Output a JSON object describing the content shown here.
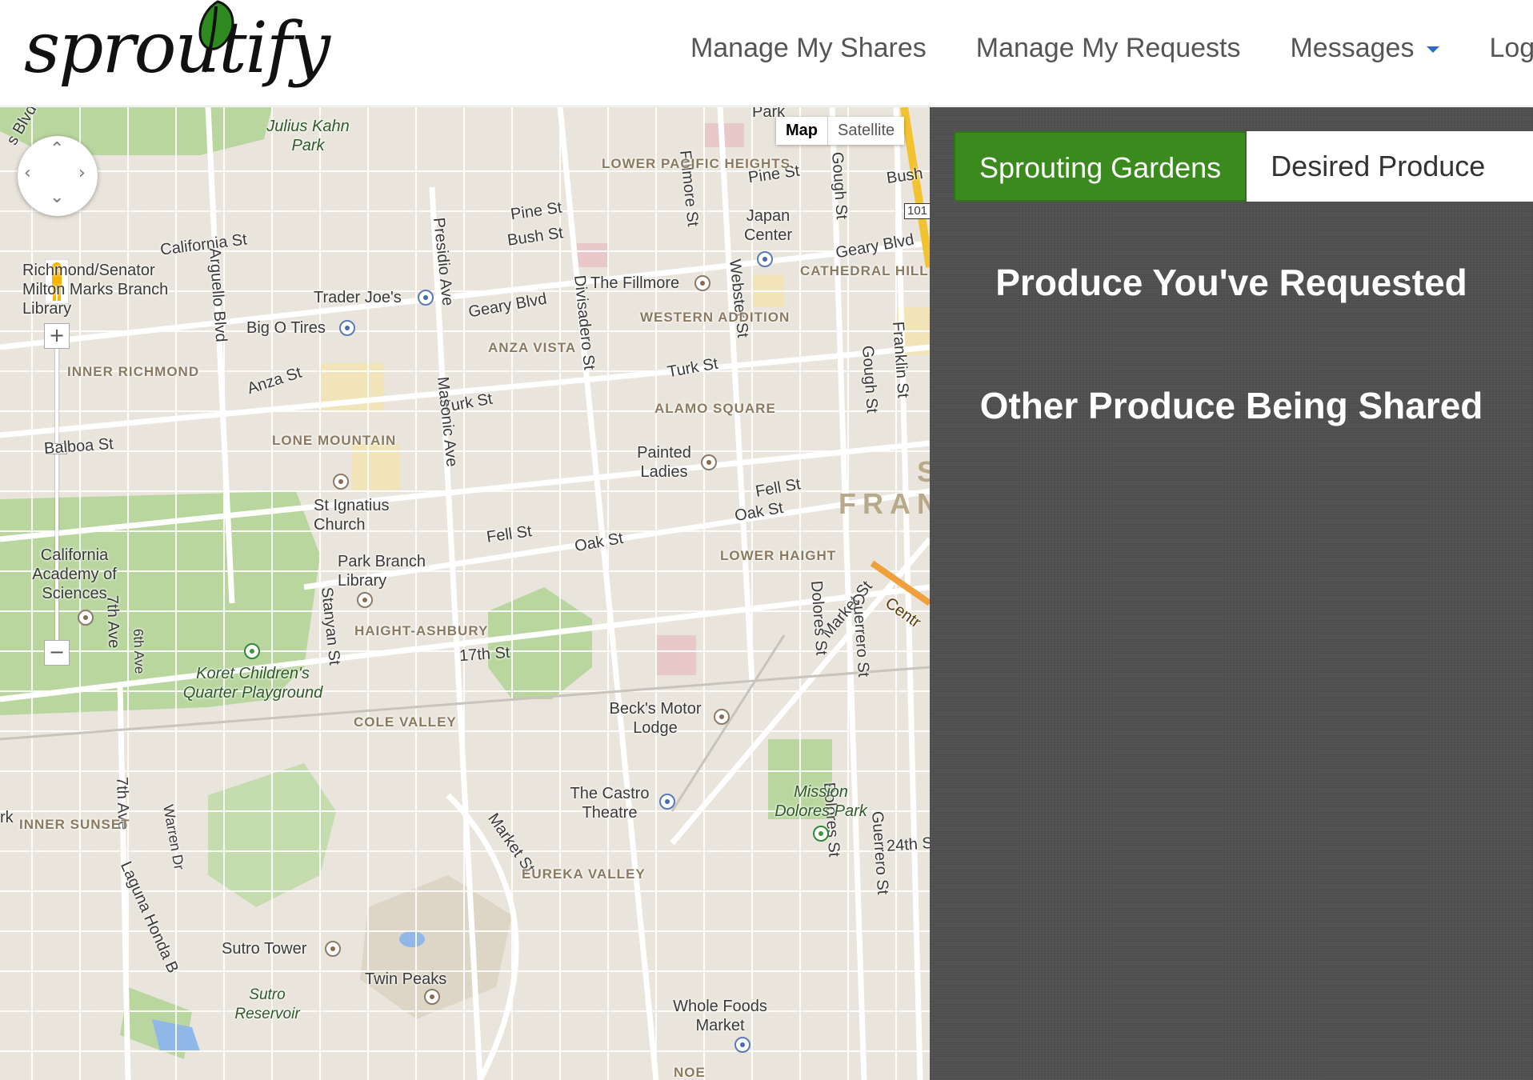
{
  "header": {
    "logo_text": "sproutify",
    "nav": [
      {
        "label": "Manage My Shares"
      },
      {
        "label": "Manage My Requests"
      },
      {
        "label": "Messages"
      },
      {
        "label": "Logou"
      }
    ]
  },
  "map": {
    "map_type": {
      "map": "Map",
      "satellite": "Satellite"
    },
    "zoom_in": "+",
    "zoom_out": "−",
    "streets": {
      "california_st": "California St",
      "pine_st_1": "Pine St",
      "pine_st_2": "Pine St",
      "bush_st_1": "Bush St",
      "bush_st_2": "Bush",
      "geary_blvd_1": "Geary Blvd",
      "geary_blvd_2": "Geary Blvd",
      "anza_st": "Anza St",
      "turk_st_1": "Turk St",
      "turk_st_2": "Turk St",
      "balboa_st": "Balboa St",
      "fell_st_1": "Fell St",
      "fell_st_2": "Fell St",
      "oak_st_1": "Oak St",
      "oak_st_2": "Oak St",
      "market_st_1": "Market St",
      "market_st_2": "Market St",
      "seventeenth_st": "17th St",
      "twentyfourth_st": "24th S",
      "presidio_ave": "Presidio Ave",
      "arguello_blvd": "Arguello Blvd",
      "masonic_ave": "Masonic Ave",
      "divisadero_st": "Divisadero St",
      "fillmore_st": "Fillmore St",
      "webster_st": "Webster St",
      "gough_st_1": "Gough St",
      "gough_st_2": "Gough St",
      "franklin_st": "Franklin St",
      "stanyan_st": "Stanyan St",
      "seventh_ave_1": "7th Ave",
      "seventh_ave_2": "7th Ave",
      "sixth_ave": "6th Ave",
      "dolores_st_1": "Dolores St",
      "dolores_st_2": "Dolores St",
      "guerrero_st_1": "Guerrero St",
      "guerrero_st_2": "Guerrero St",
      "warren_dr": "Warren Dr",
      "laguna_honda": "Laguna Honda B",
      "hwy_101": "101",
      "centr": "Centr",
      "park_top": "Park",
      "rk_left": "rk",
      "s_blvd": "s Blvd"
    },
    "districts": {
      "lower_pacific_heights": "LOWER PACIFIC HEIGHTS",
      "cathedral_hill": "CATHEDRAL HILL",
      "western_addition": "WESTERN ADDITION",
      "anza_vista": "ANZA VISTA",
      "inner_richmond": "INNER RICHMOND",
      "alamo_square": "ALAMO SQUARE",
      "lone_mountain": "LONE MOUNTAIN",
      "lower_haight": "LOWER HAIGHT",
      "haight_ashbury": "HAIGHT-ASHBURY",
      "cole_valley": "COLE VALLEY",
      "inner_sunset": "INNER SUNSET",
      "eureka_valley": "EUREKA VALLEY",
      "noe": "NOE",
      "san_francisco": "FRAN",
      "s_letter": "S"
    },
    "places": {
      "julius_kahn_park": "Julius Kahn Park",
      "richmond_library": "Richmond/Senator Milton Marks Branch Library",
      "trader_joes": "Trader Joe's",
      "big_o_tires": "Big O Tires",
      "japan_center": "Japan Center",
      "the_fillmore": "The Fillmore",
      "painted_ladies": "Painted Ladies",
      "st_ignatius": "St Ignatius Church",
      "cal_academy": "California Academy of Sciences",
      "park_branch_library": "Park Branch Library",
      "korets_playground": "Koret Children's Quarter Playground",
      "becks_motor_lodge": "Beck's Motor Lodge",
      "castro_theatre": "The Castro Theatre",
      "mission_dolores_park": "Mission Dolores Park",
      "sutro_tower": "Sutro Tower",
      "twin_peaks": "Twin Peaks",
      "sutro_reservoir": "Sutro Reservoir",
      "whole_foods": "Whole Foods Market"
    }
  },
  "panel": {
    "tabs": [
      {
        "label": "Sprouting Gardens",
        "active": true
      },
      {
        "label": "Desired Produce",
        "active": false
      }
    ],
    "heading_requested": "Produce You've Requested",
    "heading_shared": "Other Produce Being Shared"
  },
  "colors": {
    "active_tab": "#3a8a1e",
    "panel_bg": "#505050",
    "nav_text": "#555555",
    "caret": "#2a6fc0",
    "logo_leaf": "#2e8a1e"
  }
}
